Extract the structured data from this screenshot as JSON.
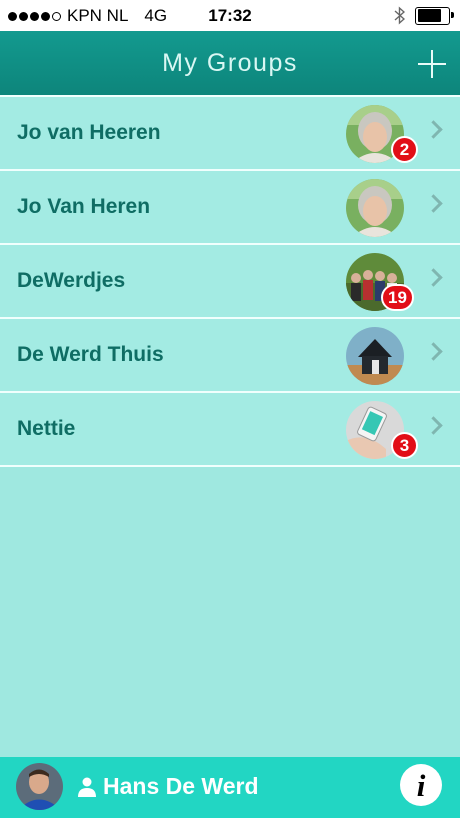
{
  "status_bar": {
    "carrier": "KPN NL",
    "network": "4G",
    "time": "17:32",
    "signal_bars_filled": 4,
    "signal_bars_total": 5,
    "battery_level": 0.78
  },
  "nav": {
    "title": "My Groups",
    "add_icon": "plus-icon"
  },
  "groups": [
    {
      "name": "Jo van Heeren",
      "badge": "2",
      "avatar": "woman-portrait"
    },
    {
      "name": "Jo Van Heren",
      "badge": "",
      "avatar": "woman-portrait"
    },
    {
      "name": "DeWerdjes",
      "badge": "19",
      "avatar": "group-photo"
    },
    {
      "name": "De Werd Thuis",
      "badge": "",
      "avatar": "house-photo"
    },
    {
      "name": "Nettie",
      "badge": "3",
      "avatar": "phone-in-hand"
    }
  ],
  "footer": {
    "user_name": "Hans De Werd",
    "info_icon": "info-icon"
  },
  "colors": {
    "nav_bg": "#108f85",
    "list_bg": "#a3ebe3",
    "text": "#0f6d64",
    "badge": "#e20e17",
    "footer_bg": "#22d6c3"
  }
}
